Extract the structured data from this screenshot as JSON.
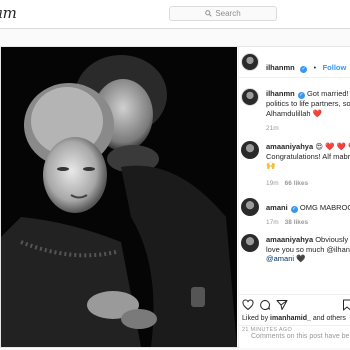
{
  "nav": {
    "logo_text": "am",
    "search_placeholder": "Search"
  },
  "post": {
    "username": "ilhanmn",
    "follow_label": "Follow",
    "caption": {
      "username": "ilhanmn",
      "lines": [
        "Got married! Fro",
        "politics to life partners, so b",
        "Alhamdulillah ❤️"
      ],
      "time": "21m"
    },
    "comments": [
      {
        "username": "amaaniyahya",
        "lines": [
          "😍 ❤️ ❤️ ❤️",
          "Congratulations! Alf mabroo",
          "🙌"
        ],
        "time": "19m",
        "likes": "66 likes"
      },
      {
        "username": "amani",
        "lines": [
          "OMG MABROOK!!"
        ],
        "time": "17m",
        "likes": "38 likes"
      },
      {
        "username": "amaaniyahya",
        "lines": [
          "Obviously",
          "love you so much @ilhanmn",
          "@amani 🖤"
        ],
        "time": "",
        "likes": ""
      }
    ],
    "liked_by_prefix": "Liked by ",
    "liked_by_user": "imanhamid_",
    "liked_by_suffix": " and others",
    "posted_ago": "21 MINUTES AGO",
    "add_comment_placeholder": "Comments on this post have be"
  },
  "colors": {
    "accent": "#3897f0",
    "mention": "#003569",
    "border": "#dbdbdb"
  },
  "icons": [
    "search-icon",
    "verified-badge-icon",
    "heart-icon",
    "comment-icon",
    "share-icon",
    "bookmark-icon",
    "more-options-icon"
  ]
}
